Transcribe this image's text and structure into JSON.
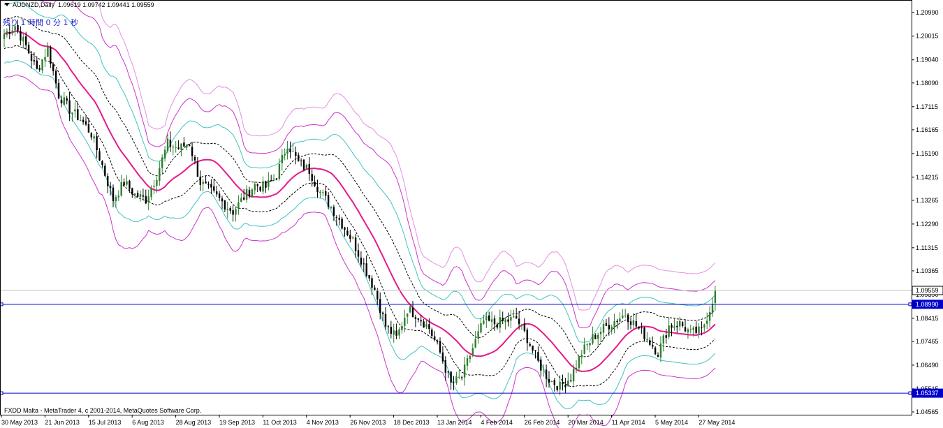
{
  "header": {
    "symbol": "AUDNZD",
    "timeframe": "Daily",
    "ohlc": "1.09619 1.09742 1.09441 1.09559"
  },
  "timer_text": "残り 1 時間 0 分 1 秒",
  "copyright": "FXDD Malta - MetaTrader 4, c 2001-2014, MetaQuotes Software Corp.",
  "colors": {
    "background": "#ffffff",
    "grid": "#000000",
    "bull_candle": "#2e7d2e",
    "bear_candle": "#000000",
    "ma_center": "#e6198c",
    "band_inner": "#000000",
    "band_middle": "#41c2c2",
    "band_outer": "#cc33cc",
    "envelope": "#e38ee3",
    "hline": "#0000cc",
    "current_price_line": "#c0c0c0"
  },
  "chart_data": {
    "type": "candlestick",
    "title": "AUDNZD Daily",
    "y_axis": {
      "range": [
        1.0445,
        1.215
      ],
      "ticks": [
        "1.20990",
        "1.20015",
        "1.19040",
        "1.18090",
        "1.17115",
        "1.16165",
        "1.15190",
        "1.14215",
        "1.13265",
        "1.12290",
        "1.11315",
        "1.10365",
        "1.09390",
        "1.08415",
        "1.07465",
        "1.06490",
        "1.05515",
        "1.04565"
      ],
      "tick_values": [
        1.2099,
        1.20015,
        1.1904,
        1.1809,
        1.17115,
        1.16165,
        1.1519,
        1.14215,
        1.13265,
        1.1229,
        1.11315,
        1.10365,
        1.0939,
        1.08415,
        1.07465,
        1.0649,
        1.05515,
        1.04565
      ]
    },
    "x_axis": {
      "labels": [
        "30 May 2013",
        "21 Jun 2013",
        "15 Jul 2013",
        "6 Aug 2013",
        "28 Aug 2013",
        "19 Sep 2013",
        "11 Oct 2013",
        "4 Nov 2013",
        "26 Nov 2013",
        "18 Dec 2013",
        "13 Jan 2014",
        "4 Feb 2014",
        "26 Feb 2014",
        "20 Mar 2014",
        "11 Apr 2014",
        "5 May 2014",
        "27 May 2014"
      ],
      "label_bar_index": [
        0,
        16,
        32,
        48,
        64,
        80,
        96,
        112,
        128,
        144,
        160,
        176,
        192,
        208,
        224,
        240,
        256
      ]
    },
    "bar_count": 262,
    "price_labels": [
      {
        "value": "1.09559",
        "type": "current"
      },
      {
        "value": "1.08990",
        "type": "hline"
      },
      {
        "value": "1.05337",
        "type": "hline"
      }
    ],
    "hlines": [
      1.0899,
      1.05337
    ],
    "current_price": 1.09559,
    "anchors": [
      {
        "i": 0,
        "c": 1.201
      },
      {
        "i": 4,
        "c": 1.2045
      },
      {
        "i": 8,
        "c": 1.196
      },
      {
        "i": 12,
        "c": 1.186
      },
      {
        "i": 16,
        "c": 1.195
      },
      {
        "i": 20,
        "c": 1.176
      },
      {
        "i": 24,
        "c": 1.17
      },
      {
        "i": 28,
        "c": 1.166
      },
      {
        "i": 32,
        "c": 1.16
      },
      {
        "i": 36,
        "c": 1.147
      },
      {
        "i": 40,
        "c": 1.133
      },
      {
        "i": 44,
        "c": 1.14
      },
      {
        "i": 48,
        "c": 1.135
      },
      {
        "i": 52,
        "c": 1.133
      },
      {
        "i": 56,
        "c": 1.143
      },
      {
        "i": 60,
        "c": 1.156
      },
      {
        "i": 64,
        "c": 1.154
      },
      {
        "i": 68,
        "c": 1.156
      },
      {
        "i": 72,
        "c": 1.14
      },
      {
        "i": 76,
        "c": 1.136
      },
      {
        "i": 80,
        "c": 1.132
      },
      {
        "i": 84,
        "c": 1.128
      },
      {
        "i": 88,
        "c": 1.134
      },
      {
        "i": 92,
        "c": 1.139
      },
      {
        "i": 96,
        "c": 1.138
      },
      {
        "i": 100,
        "c": 1.143
      },
      {
        "i": 104,
        "c": 1.156
      },
      {
        "i": 108,
        "c": 1.148
      },
      {
        "i": 112,
        "c": 1.145
      },
      {
        "i": 116,
        "c": 1.136
      },
      {
        "i": 120,
        "c": 1.13
      },
      {
        "i": 124,
        "c": 1.123
      },
      {
        "i": 128,
        "c": 1.116
      },
      {
        "i": 132,
        "c": 1.106
      },
      {
        "i": 136,
        "c": 1.096
      },
      {
        "i": 140,
        "c": 1.081
      },
      {
        "i": 144,
        "c": 1.076
      },
      {
        "i": 148,
        "c": 1.088
      },
      {
        "i": 152,
        "c": 1.085
      },
      {
        "i": 156,
        "c": 1.08
      },
      {
        "i": 160,
        "c": 1.07
      },
      {
        "i": 164,
        "c": 1.057
      },
      {
        "i": 168,
        "c": 1.06
      },
      {
        "i": 172,
        "c": 1.072
      },
      {
        "i": 176,
        "c": 1.083
      },
      {
        "i": 180,
        "c": 1.082
      },
      {
        "i": 184,
        "c": 1.083
      },
      {
        "i": 188,
        "c": 1.084
      },
      {
        "i": 192,
        "c": 1.076
      },
      {
        "i": 196,
        "c": 1.066
      },
      {
        "i": 200,
        "c": 1.059
      },
      {
        "i": 204,
        "c": 1.056
      },
      {
        "i": 208,
        "c": 1.06
      },
      {
        "i": 212,
        "c": 1.07
      },
      {
        "i": 216,
        "c": 1.076
      },
      {
        "i": 220,
        "c": 1.08
      },
      {
        "i": 224,
        "c": 1.083
      },
      {
        "i": 228,
        "c": 1.086
      },
      {
        "i": 232,
        "c": 1.081
      },
      {
        "i": 236,
        "c": 1.076
      },
      {
        "i": 240,
        "c": 1.07
      },
      {
        "i": 244,
        "c": 1.081
      },
      {
        "i": 248,
        "c": 1.082
      },
      {
        "i": 252,
        "c": 1.078
      },
      {
        "i": 256,
        "c": 1.079
      },
      {
        "i": 259,
        "c": 1.088
      },
      {
        "i": 261,
        "c": 1.0956
      }
    ]
  }
}
